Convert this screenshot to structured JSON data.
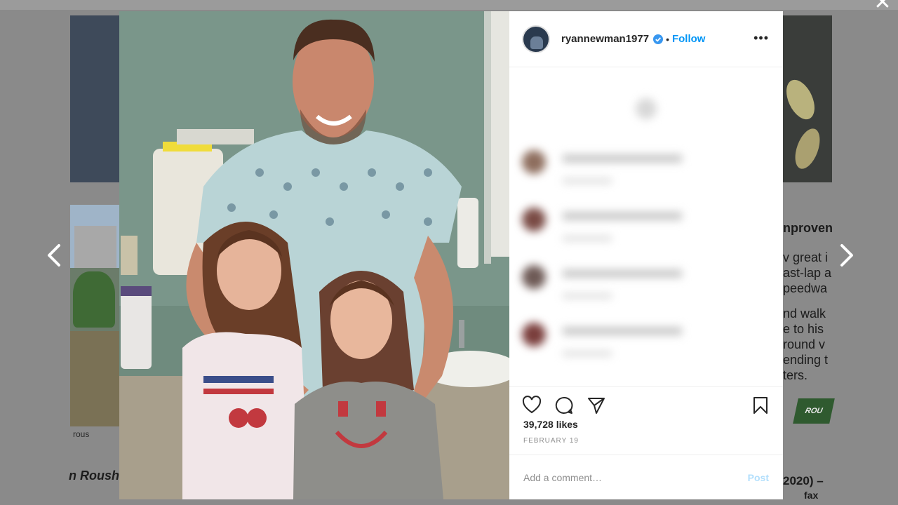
{
  "background": {
    "left_caption": "rous",
    "left_bold_text": "n Roush",
    "right_heading": "nproven",
    "right_paragraphs": [
      "v great i",
      "ast-lap a",
      "peedwa",
      "nd walk",
      "e to his",
      "round v",
      "ending t",
      "ters."
    ],
    "right_logo": "ROU",
    "right_year": "2020) –",
    "right_fax": "fax"
  },
  "overlay": {
    "close_glyph": "✕"
  },
  "post": {
    "username": "ryannewman1977",
    "separator": "•",
    "follow_label": "Follow",
    "more_glyph": "•••",
    "likes": "39,728 likes",
    "date": "FEBRUARY 19",
    "comment_placeholder": "Add a comment…",
    "post_label": "Post"
  },
  "icons": {
    "heart": "heart-icon",
    "comment": "comment-icon",
    "share": "share-icon",
    "save": "bookmark-icon",
    "verified": "verified-badge-icon"
  },
  "colors": {
    "accent": "#0095f6",
    "post_disabled": "#b2dffc"
  }
}
